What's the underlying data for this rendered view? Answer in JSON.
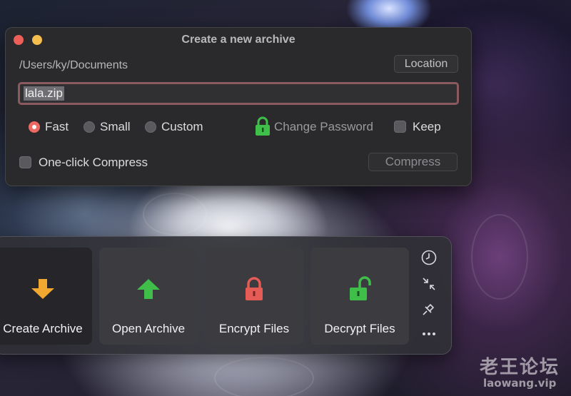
{
  "dialog": {
    "title": "Create a new archive",
    "path": "/Users/ky/Documents",
    "location_button": "Location",
    "filename": "lala.zip",
    "modes": [
      {
        "label": "Fast",
        "selected": true
      },
      {
        "label": "Small",
        "selected": false
      },
      {
        "label": "Custom",
        "selected": false
      }
    ],
    "change_password": "Change Password",
    "keep_label": "Keep",
    "one_click_label": "One-click Compress",
    "compress_button": "Compress"
  },
  "toolbar": {
    "tiles": [
      {
        "label": "Create Archive",
        "icon": "download-arrow-icon",
        "color": "#f0a830"
      },
      {
        "label": "Open Archive",
        "icon": "upload-arrow-icon",
        "color": "#3fbe4a"
      },
      {
        "label": "Encrypt Files",
        "icon": "lock-icon",
        "color": "#e55b56"
      },
      {
        "label": "Decrypt Files",
        "icon": "unlock-icon",
        "color": "#3fbe4a"
      }
    ],
    "side_icons": [
      "clock-icon",
      "collapse-icon",
      "pin-icon",
      "more-icon"
    ]
  },
  "watermark": {
    "name": "老王论坛",
    "url": "laowang.vip"
  }
}
